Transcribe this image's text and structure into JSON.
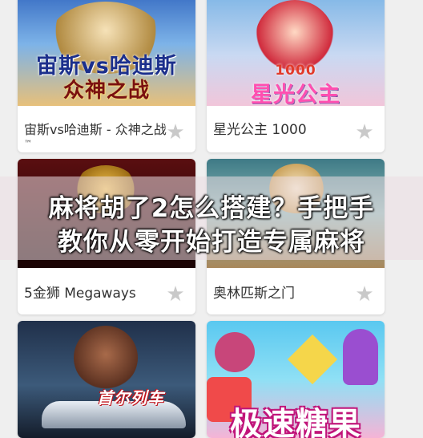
{
  "games": [
    {
      "caption": "宙斯vs哈迪斯 - 众神之战",
      "tm": "™",
      "art_line1": "宙斯vs哈迪斯",
      "art_line2": "众神之战"
    },
    {
      "caption": "星光公主 1000",
      "art_line1": "1000",
      "art_line2": "星光公主"
    },
    {
      "caption": "5金狮 Megaways"
    },
    {
      "caption": "奥林匹斯之门"
    },
    {
      "art_line1": "首尔列车"
    },
    {
      "art_line1": "极速糖果"
    }
  ],
  "headline": {
    "line1": "麻将胡了2怎么搭建？手把手",
    "line2": "教你从零开始打造专属麻将"
  },
  "icons": {
    "star": "star-icon"
  },
  "colors": {
    "star": "#c9c9c9",
    "caption": "#333333"
  }
}
